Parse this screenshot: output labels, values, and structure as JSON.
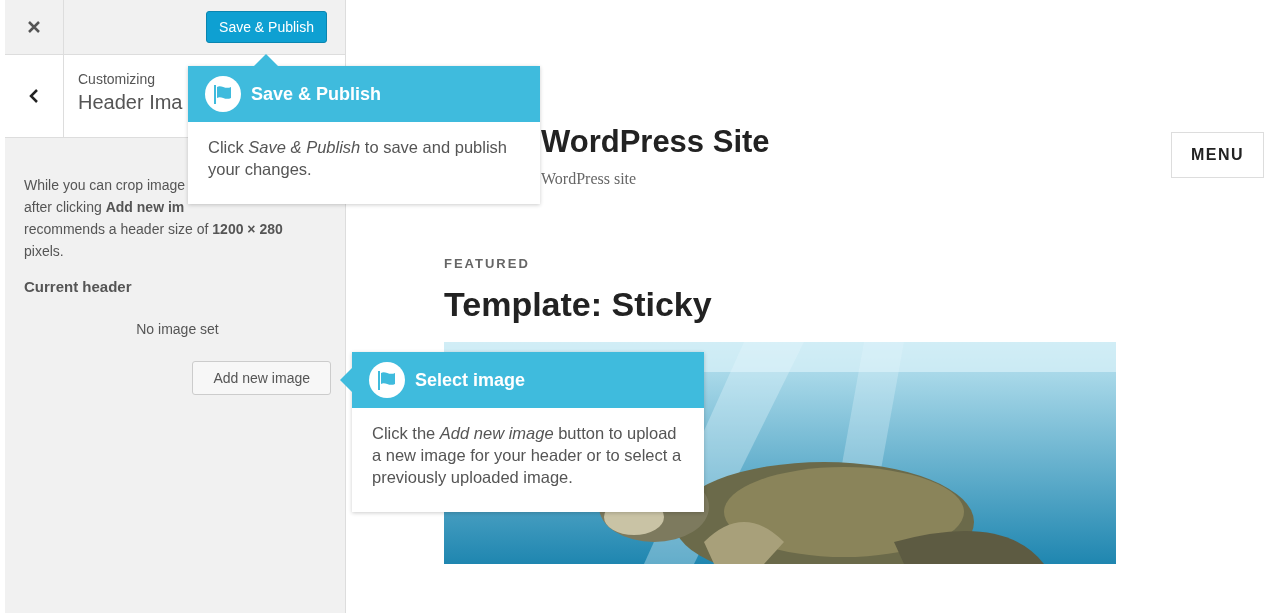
{
  "sidebar": {
    "save_button": "Save & Publish",
    "breadcrumb": "Customizing",
    "section_title": "Header Ima",
    "description_lines": [
      "While you can crop image",
      "after clicking **Add new im**",
      "recommends a header size of **1200 × 280**",
      "pixels."
    ],
    "current_header_label": "Current header",
    "no_image_text": "No image set",
    "add_button": "Add new image"
  },
  "preview": {
    "site_title": "WordPress Site",
    "tagline": "WordPress site",
    "menu_button": "MENU",
    "featured_label": "FEATURED",
    "post_title": "Template: Sticky"
  },
  "tooltips": [
    {
      "title": "Save & Publish",
      "body": "Click *Save & Publish* to save and publish your changes."
    },
    {
      "title": "Select image",
      "body": "Click the *Add new image* button to upload a new image for your header or to select a previously uploaded image."
    }
  ]
}
